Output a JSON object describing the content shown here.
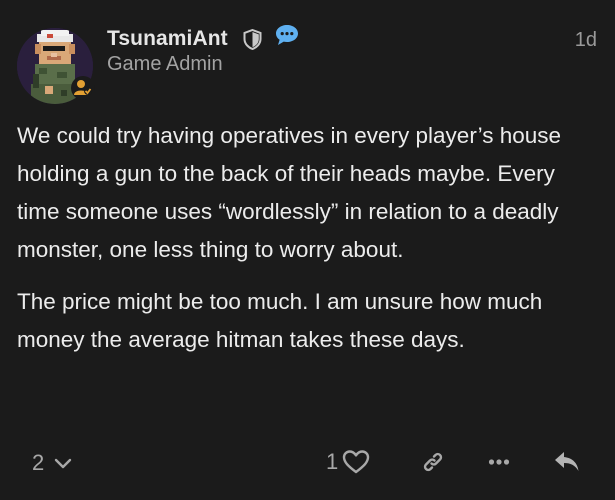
{
  "post": {
    "username": "TsunamiAnt",
    "user_title": "Game Admin",
    "date": "1d",
    "paragraphs": [
      "We could try having operatives in every player’s house holding a gun to the back of their heads maybe. Every time someone uses “wordlessly” in relation to a deadly monster, one less thing to worry about.",
      "The price might be too much. I am unsure how much money the average hitman takes these days."
    ]
  },
  "actions": {
    "replies_count": "2",
    "likes_count": "1"
  },
  "icons": {
    "moderator": "shield-icon",
    "messaging": "speech-bubble-icon",
    "flair": "user-badge-icon",
    "replies": "chevron-down-icon",
    "like": "heart-icon",
    "share": "link-icon",
    "more": "more-dots-icon",
    "reply": "reply-arrow-icon"
  },
  "colors": {
    "background": "#1b1b1b",
    "speech_accent": "#5fb0f0",
    "flair_accent": "#e3a033"
  }
}
